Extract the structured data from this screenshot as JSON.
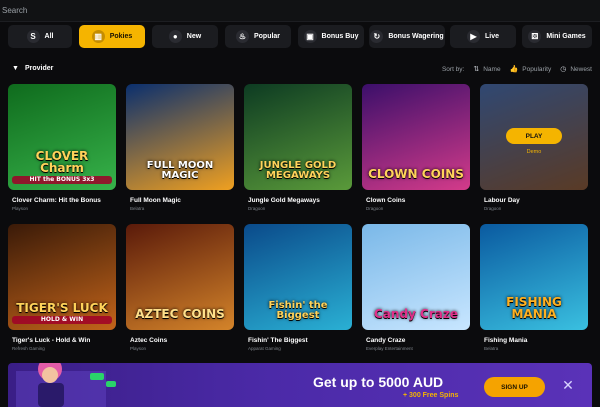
{
  "search": {
    "placeholder": "Search"
  },
  "categories": [
    {
      "label": "All",
      "icon": "slots-s-icon"
    },
    {
      "label": "Pokies",
      "icon": "slot-machine-icon",
      "active": true
    },
    {
      "label": "New",
      "icon": "new-badge-icon"
    },
    {
      "label": "Popular",
      "icon": "flame-icon"
    },
    {
      "label": "Bonus Buy",
      "icon": "gift-icon"
    },
    {
      "label": "Bonus Wagering",
      "icon": "wagering-icon"
    },
    {
      "label": "Live",
      "icon": "live-icon"
    },
    {
      "label": "Mini Games",
      "icon": "dice-icon"
    }
  ],
  "filter": {
    "provider_label": "Provider",
    "sort_by_label": "Sort by:",
    "sort_options": [
      {
        "label": "Name",
        "icon": "az-sort-icon"
      },
      {
        "label": "Popularity",
        "icon": "thumbs-up-icon"
      },
      {
        "label": "Newest",
        "icon": "clock-icon"
      }
    ]
  },
  "games": [
    {
      "name": "Clover Charm: Hit the Bonus",
      "provider": "Playson",
      "art_text": "CLOVER Charm",
      "art_tag": "HIT the BONUS 3x3",
      "colors": [
        "#0f6b1d",
        "#37b24a"
      ],
      "text_color": "#ffd35a"
    },
    {
      "name": "Full Moon Magic",
      "provider": "Belatra",
      "art_text": "FULL MOON MAGIC",
      "colors": [
        "#0a2f6e",
        "#f0a020"
      ],
      "text_color": "#ffffff"
    },
    {
      "name": "Jungle Gold Megaways",
      "provider": "Dragoon",
      "art_text": "JUNGLE GOLD MEGAWAYS",
      "colors": [
        "#0d3b22",
        "#5a9a3a"
      ],
      "text_color": "#ffd35a"
    },
    {
      "name": "Clown Coins",
      "provider": "Dragoon",
      "art_text": "CLOWN COINS",
      "colors": [
        "#3b0f6a",
        "#d43b8a"
      ],
      "text_color": "#ffd35a"
    },
    {
      "name": "Labour Day",
      "provider": "Dragoon",
      "art_text": "",
      "colors": [
        "#4a6fb0",
        "#8a5a3a"
      ],
      "text_color": "#ffffff",
      "hover": true,
      "play_label": "PLAY",
      "demo_label": "Demo"
    },
    {
      "name": "Tiger's Luck - Hold & Win",
      "provider": "Refresh Gaming",
      "art_text": "TIGER'S LUCK",
      "art_tag": "HOLD & WIN",
      "colors": [
        "#3a1a08",
        "#c2641a"
      ],
      "text_color": "#ffd35a"
    },
    {
      "name": "Aztec Coins",
      "provider": "Playson",
      "art_text": "AZTEC COINS",
      "colors": [
        "#5a1a0a",
        "#d4842a"
      ],
      "text_color": "#ffe08a"
    },
    {
      "name": "Fishin' The Biggest",
      "provider": "Apparat Gaming",
      "art_text": "Fishin' the Biggest",
      "colors": [
        "#0a4a8a",
        "#2ab0d4"
      ],
      "text_color": "#ffd35a"
    },
    {
      "name": "Candy Craze",
      "provider": "Everplay Entertainment",
      "art_text": "Candy Craze",
      "colors": [
        "#7ab8e8",
        "#c8e6ff"
      ],
      "text_color": "#e0308a"
    },
    {
      "name": "Fishing Mania",
      "provider": "Belatra",
      "art_text": "FISHING MANIA",
      "colors": [
        "#0a5aa0",
        "#3ac0e0"
      ],
      "text_color": "#ffb020"
    }
  ],
  "promo": {
    "headline": "Get up to 5000 AUD",
    "subline": "+ 300 Free Spins",
    "cta": "SIGN UP",
    "accent": "#f5a300"
  },
  "colors": {
    "accent": "#f5b400",
    "background": "#0b0b0d",
    "card": "#1b1c20"
  }
}
